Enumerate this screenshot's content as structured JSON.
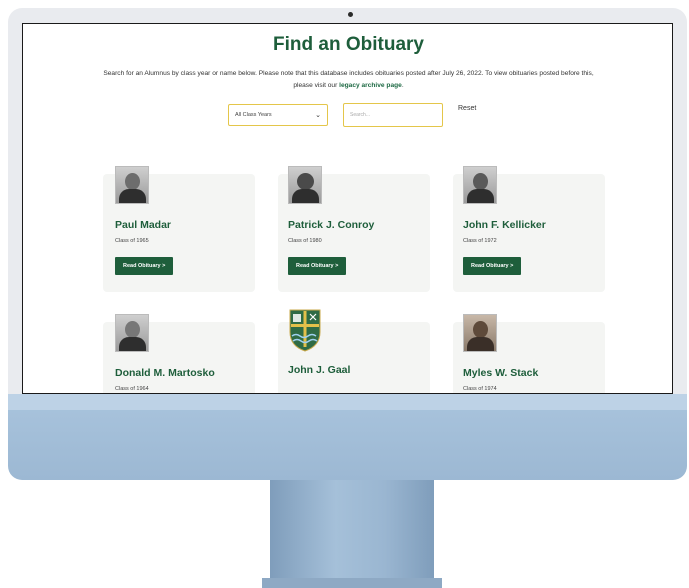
{
  "page": {
    "title": "Find an Obituary",
    "intro_text": "Search for an Alumnus by class year or name below. Please note that this database includes obituaries posted after July 26, 2022. To view obituaries posted before this, please visit our",
    "intro_link": "legacy archive page",
    "intro_end": "."
  },
  "filters": {
    "class_years_selected": "All Class Years",
    "search_placeholder": "Search...",
    "reset_label": "Reset"
  },
  "button_label": "Read Obituary >",
  "cards": [
    {
      "name": "Paul Madar",
      "class": "Class of 1965"
    },
    {
      "name": "Patrick J. Conroy",
      "class": "Class of 1980"
    },
    {
      "name": "John F. Kellicker",
      "class": "Class of 1972"
    },
    {
      "name": "Donald M. Martosko",
      "class": "Class of 1964"
    },
    {
      "name": "John J. Gaal",
      "class": ""
    },
    {
      "name": "Myles W. Stack",
      "class": "Class of 1974"
    }
  ],
  "colors": {
    "accent": "#1e5e3b",
    "input_border": "#e4c64a",
    "device": "#a9c4dd"
  }
}
